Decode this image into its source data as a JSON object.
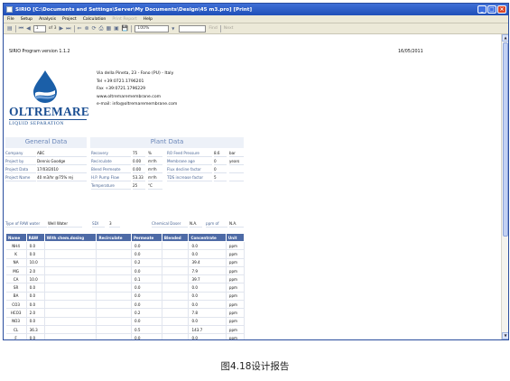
{
  "window": {
    "title": "SIRIO [C:\\Documents and Settings\\Server\\My Documents\\Design\\45 m3.pro]   [Print]"
  },
  "menu": {
    "items": [
      "File",
      "Setup",
      "Analysis",
      "Project",
      "Calculation",
      "Print Report",
      "Help"
    ],
    "disabled_index": 5
  },
  "toolbar": {
    "page_current": "1",
    "page_of": "of 3",
    "zoom": "100%",
    "find_label": "Find",
    "next_label": "Next"
  },
  "report": {
    "version": "SIRIO Program version 1.1.2",
    "date": "16/05/2011",
    "logo": {
      "brand": "OLTREMARE",
      "tagline": "LIQUID SEPARATION"
    },
    "contact": [
      "Via della Pineta, 23 - Fano (PU) - Italy",
      "Tel +39:0721.1796201",
      "Fax +39:0721.1796229",
      "www.oltremaremembrane.com",
      "e-mail: info@oltremaremembrane.com"
    ],
    "general": {
      "title": "General Data",
      "rows": [
        {
          "label": "Company",
          "value": "ABC"
        },
        {
          "label": "Project by",
          "value": "Dennis Goodge"
        },
        {
          "label": "Project Data",
          "value": "17/03/2010"
        },
        {
          "label": "Project Name",
          "value": "40 m3/hr @75% rej"
        }
      ]
    },
    "plant": {
      "title": "Plant Data",
      "left": [
        {
          "label": "Recovery",
          "value": "75",
          "unit": "%"
        },
        {
          "label": "Recirculate",
          "value": "0.00",
          "unit": "m³/h"
        },
        {
          "label": "Blend Permeate",
          "value": "0.00",
          "unit": "m³/h"
        },
        {
          "label": "H.P. Pump Flow",
          "value": "53.33",
          "unit": "m³/h"
        },
        {
          "label": "Temperature",
          "value": "25",
          "unit": "°C"
        }
      ],
      "right": [
        {
          "label": "RO Feed Pressure",
          "value": "8.6",
          "unit": "bar"
        },
        {
          "label": "Membrane age",
          "value": "0",
          "unit": "years"
        },
        {
          "label": "Flux decline factor",
          "value": "0",
          "unit": ""
        },
        {
          "label": "TDS increase factor",
          "value": "5",
          "unit": ""
        }
      ]
    },
    "raw": {
      "type_label": "Type of RAW water",
      "type_value": "Well Water",
      "sdi_label": "SDI",
      "sdi_value": "3",
      "chem_label": "Chemical Doser",
      "chem_value": "N.A.",
      "ppm_label": "ppm of",
      "ppm_value": "N.A."
    },
    "table": {
      "headers": [
        "Name",
        "RAW",
        "With chem.dosing",
        "Recirculate",
        "Permeate",
        "Blended",
        "Concentrate",
        "Unit"
      ],
      "rows": [
        [
          "NH4",
          "0.0",
          "",
          "",
          "0.0",
          "",
          "0.0",
          "ppm"
        ],
        [
          "K",
          "0.0",
          "",
          "",
          "0.0",
          "",
          "0.0",
          "ppm"
        ],
        [
          "NA",
          "10.0",
          "",
          "",
          "0.2",
          "",
          "39.4",
          "ppm"
        ],
        [
          "MG",
          "2.0",
          "",
          "",
          "0.0",
          "",
          "7.9",
          "ppm"
        ],
        [
          "CA",
          "10.0",
          "",
          "",
          "0.1",
          "",
          "39.7",
          "ppm"
        ],
        [
          "SR",
          "0.0",
          "",
          "",
          "0.0",
          "",
          "0.0",
          "ppm"
        ],
        [
          "BA",
          "0.0",
          "",
          "",
          "0.0",
          "",
          "0.0",
          "ppm"
        ],
        [
          "CO3",
          "0.0",
          "",
          "",
          "0.0",
          "",
          "0.0",
          "ppm"
        ],
        [
          "HCO3",
          "2.0",
          "",
          "",
          "0.2",
          "",
          "7.8",
          "ppm"
        ],
        [
          "NO3",
          "0.0",
          "",
          "",
          "0.0",
          "",
          "0.0",
          "ppm"
        ],
        [
          "CL",
          "36.3",
          "",
          "",
          "0.5",
          "",
          "143.7",
          "ppm"
        ],
        [
          "F",
          "0.0",
          "",
          "",
          "0.0",
          "",
          "0.0",
          "ppm"
        ],
        [
          "SO4",
          "2.0",
          "",
          "",
          "0.0",
          "",
          "8.0",
          "ppm"
        ],
        [
          "SIO2",
          "10.0",
          "",
          "",
          "0.1",
          "",
          "39.6",
          "ppm"
        ],
        [
          "B",
          "0.0",
          "",
          "",
          "0.0",
          "",
          "0.0",
          "ppm"
        ]
      ]
    }
  },
  "caption": "图4.18设计报告"
}
